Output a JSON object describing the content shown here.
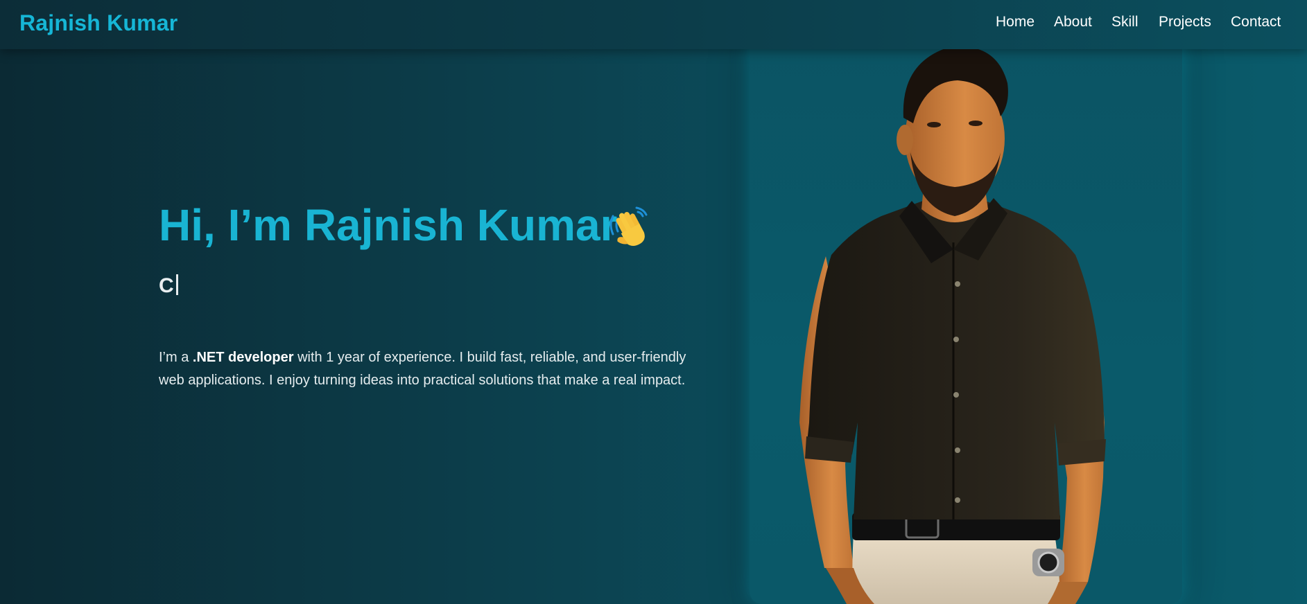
{
  "header": {
    "brand": "Rajnish Kumar",
    "nav": {
      "home": "Home",
      "about": "About",
      "skill": "Skill",
      "projects": "Projects",
      "contact": "Contact"
    }
  },
  "hero": {
    "title": "Hi, I’m Rajnish Kumar",
    "wave_icon": "waving-hand-icon",
    "typed_text": "C",
    "intro": {
      "lead": "I’m a ",
      "highlight": ".NET developer",
      "rest": " with 1 year of experience. I build fast, reliable, and user-friendly web applications. I enjoy turning ideas into practical solutions that make a real impact."
    }
  },
  "colors": {
    "accent": "#19b4d3",
    "background_dark": "#0b2a34",
    "background_teal": "#0a5b6b"
  }
}
